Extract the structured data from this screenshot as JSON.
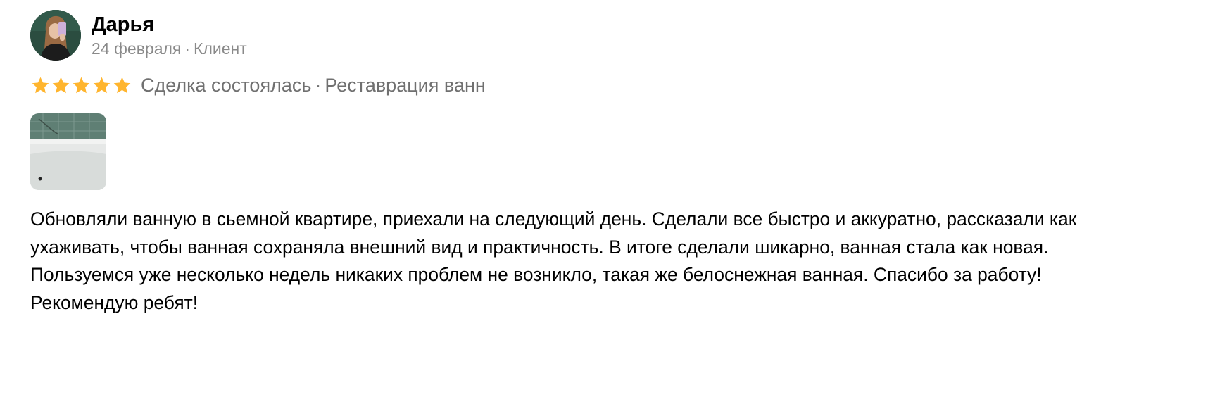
{
  "author": {
    "name": "Дарья",
    "date": "24 февраля",
    "separator": "·",
    "role": "Клиент"
  },
  "rating": {
    "stars": 5,
    "max": 5,
    "star_color": "#ffb52e",
    "deal_status": "Сделка состоялась",
    "separator": "·",
    "service": "Реставрация ванн"
  },
  "photo": {
    "icon": "bathtub-photo-thumbnail"
  },
  "review": {
    "paragraph_1": "Обновляли ванную в сьемной квартире, приехали на следующий день. Сделали все быстро и аккуратно, рассказали как ухаживать, чтобы ванная сохраняла внешний вид и практичность. В итоге сделали шикарно, ванная стала как новая. Пользуемся уже несколько недель никаких проблем не возникло, такая же белоснежная ванная. Спасибо за работу!",
    "paragraph_2": "Рекомендую ребят!"
  }
}
